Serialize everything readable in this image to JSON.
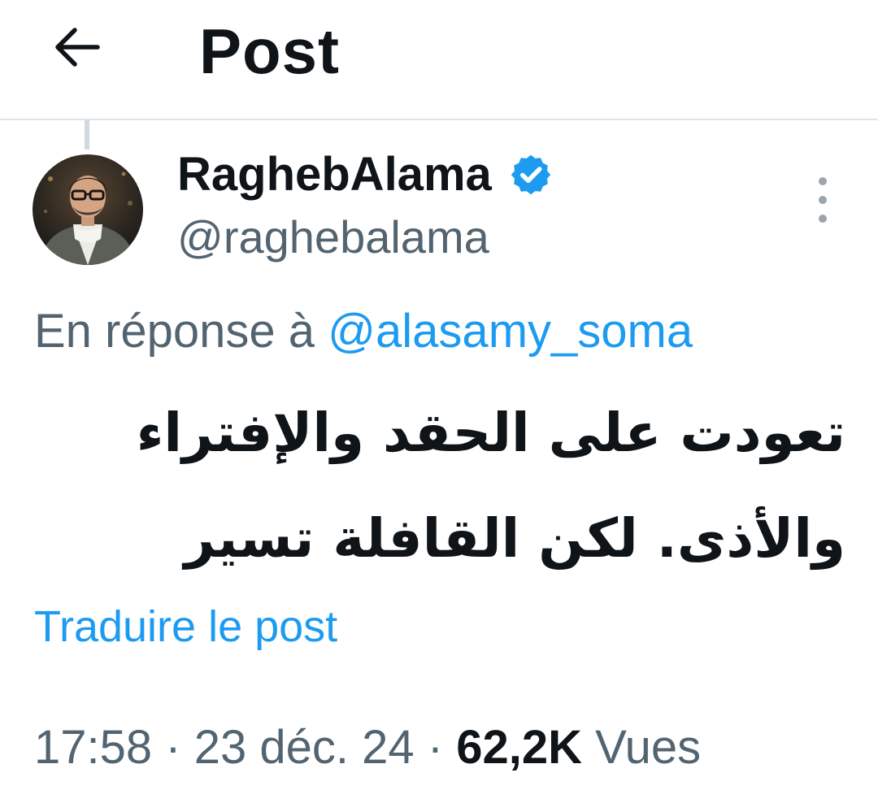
{
  "header": {
    "back_icon": "arrow-left-icon",
    "title": "Post"
  },
  "author": {
    "display_name": "RaghebAlama",
    "verified_icon": "verified-badge-icon",
    "verified_color": "#1d9bf0",
    "handle": "@raghebalama"
  },
  "more_icon": "vertical-ellipsis-icon",
  "reply": {
    "prefix": "En réponse à",
    "mention": "@alasamy_soma"
  },
  "tweet": {
    "lines": [
      "تعودت على الحقد والإفتراء",
      "والأذى. لكن القافلة تسير"
    ]
  },
  "translate_label": "Traduire le post",
  "meta": {
    "time": "17:58",
    "separator": "·",
    "date": "23 déc. 24",
    "views_count": "62,2K",
    "views_label": "Vues"
  },
  "colors": {
    "accent": "#1d9bf0",
    "secondary_text": "#536471",
    "primary_text": "#0f1419",
    "divider": "#dfe3e6"
  }
}
